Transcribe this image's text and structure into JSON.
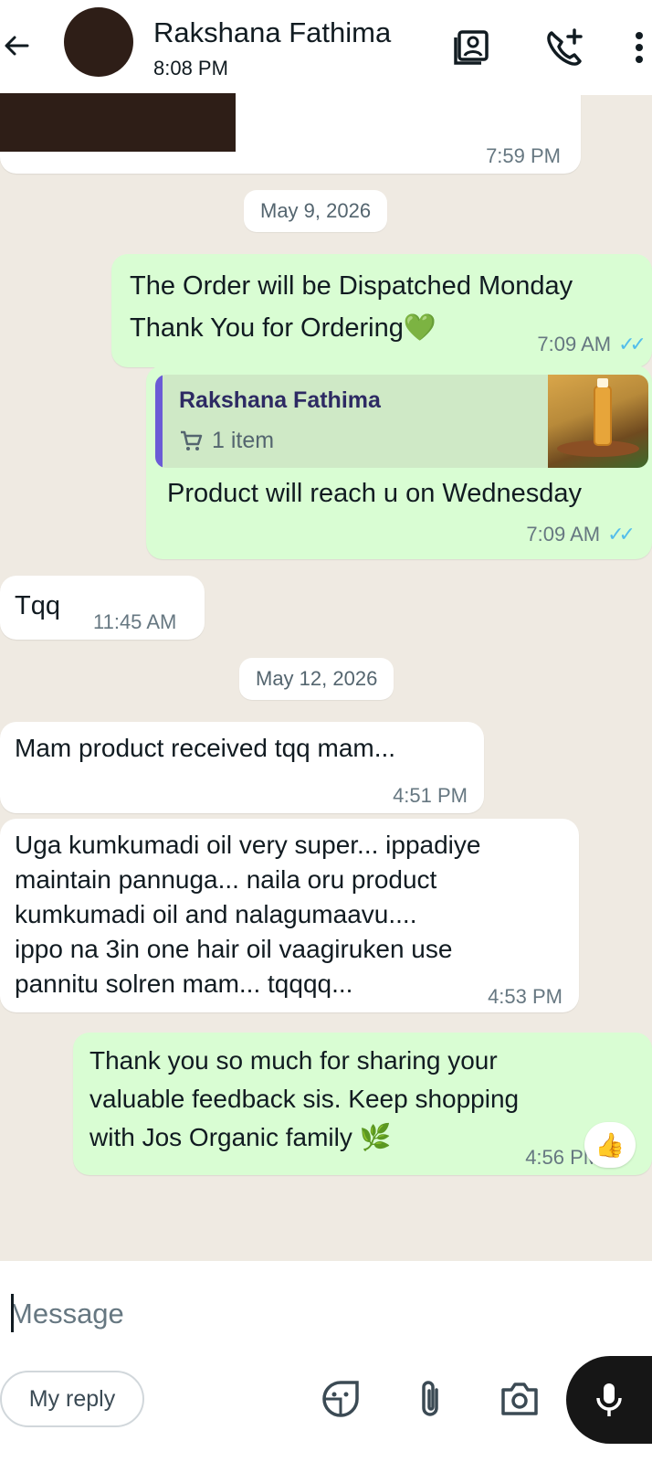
{
  "header": {
    "contact_name": "Rakshana Fathima",
    "status": "8:08 PM"
  },
  "messages": {
    "m0": {
      "time": "7:59 PM"
    },
    "date1": "May 9, 2026",
    "m1": {
      "text": "The Order will be Dispatched Monday\nThank You for Ordering💚",
      "time": "7:09 AM"
    },
    "m2": {
      "quote_name": "Rakshana Fathima",
      "quote_items": "1 item",
      "text": "Product will reach u on Wednesday",
      "time": "7:09 AM"
    },
    "m3": {
      "text": "Tqq",
      "time": "11:45 AM"
    },
    "date2": "May 12, 2026",
    "m4": {
      "text": "Mam product received tqq mam...",
      "time": "4:51 PM"
    },
    "m5": {
      "text": "Uga kumkumadi oil very super... ippadiye\nmaintain pannuga... naila oru product\nkumkumadi oil and nalagumaavu....\nippo na 3in one hair oil vaagiruken use\npannitu solren mam... tqqqq...",
      "time": "4:53 PM"
    },
    "m6": {
      "text": "Thank you so much for sharing your\nvaluable feedback sis. Keep shopping\nwith Jos Organic family 🌿",
      "time": "4:56 PM",
      "reaction": "👍"
    }
  },
  "composer": {
    "placeholder": "Message",
    "my_reply": "My reply"
  },
  "colors": {
    "outgoing_bubble": "#d9fdd3",
    "incoming_bubble": "#ffffff",
    "chat_bg": "#efeae2",
    "read_ticks": "#53bdeb"
  },
  "icons": [
    "back-arrow-icon",
    "catalog-icon",
    "add-call-icon",
    "more-vert-icon",
    "cart-icon",
    "sticker-icon",
    "attach-icon",
    "camera-icon",
    "mic-icon"
  ]
}
